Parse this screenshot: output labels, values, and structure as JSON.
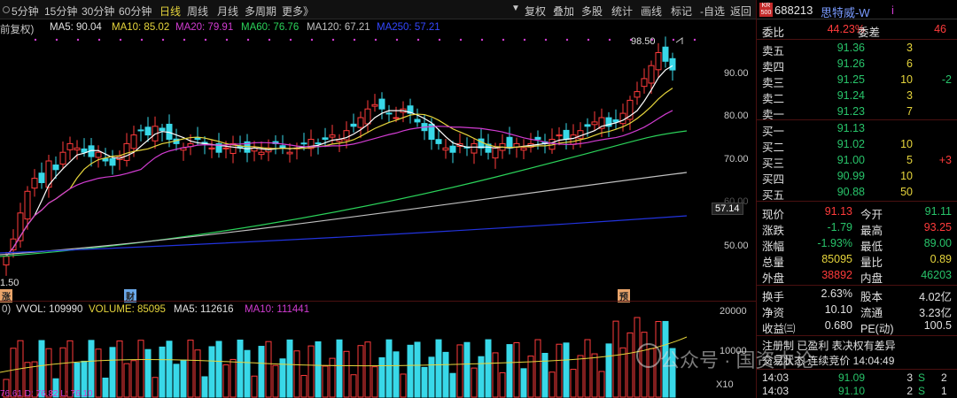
{
  "periods": [
    "5分钟",
    "15分钟",
    "30分钟",
    "60分钟",
    "日线",
    "周线",
    "月线",
    "多周期",
    "更多》"
  ],
  "tools": [
    "复权",
    "叠加",
    "多股",
    "统计",
    "画线",
    "标记",
    "-自选",
    "返回"
  ],
  "ma_legend": {
    "fq": "前复权)",
    "ma5": "MA5: 90.04",
    "ma10": "MA10: 85.02",
    "ma20": "MA20: 79.91",
    "ma60": "MA60: 76.76",
    "ma120": "MA120: 67.21",
    "ma250": "MA250: 57.21"
  },
  "price_axis": [
    "90.00",
    "80.00",
    "70.00",
    "60.00",
    "50.00"
  ],
  "price_tag": "57.14",
  "high_label": "98.50",
  "low_label": "1.50",
  "markers": [
    "涨",
    "财",
    "预"
  ],
  "vol_legend": {
    "prefix": "0)",
    "vvol": "VVOL: 109990",
    "volume": "VOLUME: 85095",
    "ma5": "MA5: 112616",
    "ma10": "MA10: 111441"
  },
  "vol_axis": [
    "20000",
    "10000",
    "X10"
  ],
  "vol_bottom": "76.61   D: 76.82   L: 76.10",
  "stock": {
    "badge": "KR 500",
    "code": "688213",
    "name": "思特威-W",
    "name_suffix": "i"
  },
  "order_book": {
    "ratio_label": "委比",
    "ratio_value": "44.23%",
    "diff_label": "委差",
    "diff_value": "46",
    "asks": [
      {
        "label": "卖五",
        "price": "91.36",
        "vol": "3",
        "chg": ""
      },
      {
        "label": "卖四",
        "price": "91.26",
        "vol": "6",
        "chg": ""
      },
      {
        "label": "卖三",
        "price": "91.25",
        "vol": "10",
        "chg": "-2"
      },
      {
        "label": "卖二",
        "price": "91.24",
        "vol": "3",
        "chg": ""
      },
      {
        "label": "卖一",
        "price": "91.23",
        "vol": "7",
        "chg": ""
      }
    ],
    "bids": [
      {
        "label": "买一",
        "price": "91.13",
        "vol": "",
        "chg": ""
      },
      {
        "label": "买二",
        "price": "91.02",
        "vol": "10",
        "chg": ""
      },
      {
        "label": "买三",
        "price": "91.00",
        "vol": "5",
        "chg": "+3"
      },
      {
        "label": "买四",
        "price": "90.99",
        "vol": "10",
        "chg": ""
      },
      {
        "label": "买五",
        "price": "90.88",
        "vol": "50",
        "chg": ""
      }
    ]
  },
  "stats": {
    "xj_l": "现价",
    "xj_v": "91.13",
    "jk_l": "今开",
    "jk_v": "91.11",
    "zd_l": "涨跌",
    "zd_v": "-1.79",
    "zg_l": "最高",
    "zg_v": "93.25",
    "zf_l": "涨幅",
    "zf_v": "-1.93%",
    "zd2_l": "最低",
    "zd2_v": "89.00",
    "zl_l": "总量",
    "zl_v": "85095",
    "lb_l": "量比",
    "lb_v": "0.89",
    "wp_l": "外盘",
    "wp_v": "38892",
    "np_l": "内盘",
    "np_v": "46203",
    "hs_l": "换手",
    "hs_v": "2.63%",
    "gb_l": "股本",
    "gb_v": "4.02亿",
    "jz_l": "净资",
    "jz_v": "10.10",
    "lt_l": "流通",
    "lt_v": "3.23亿",
    "sy_l": "收益㈢",
    "sy_v": "0.680",
    "pe_l": "PE(动)",
    "pe_v": "100.5"
  },
  "notices": [
    "注册制 已盈利 表决权有差异",
    "交易状态 连续竞价 14:04:49"
  ],
  "ticks": [
    {
      "time": "14:03",
      "price": "91.09",
      "vol": "3",
      "side": "S",
      "n": "2"
    },
    {
      "time": "14:03",
      "price": "91.10",
      "vol": "2",
      "side": "S",
      "n": "1"
    }
  ],
  "watermark": "公众号 · 国资本论",
  "colors": {
    "up": "#ff3b3b",
    "down": "#38d8e8",
    "ma5": "#ffffff",
    "ma10": "#e6d53c",
    "ma20": "#d13cd1",
    "ma60": "#2bd35a",
    "ma120": "#c0c0c0",
    "ma250": "#2233dd"
  }
}
